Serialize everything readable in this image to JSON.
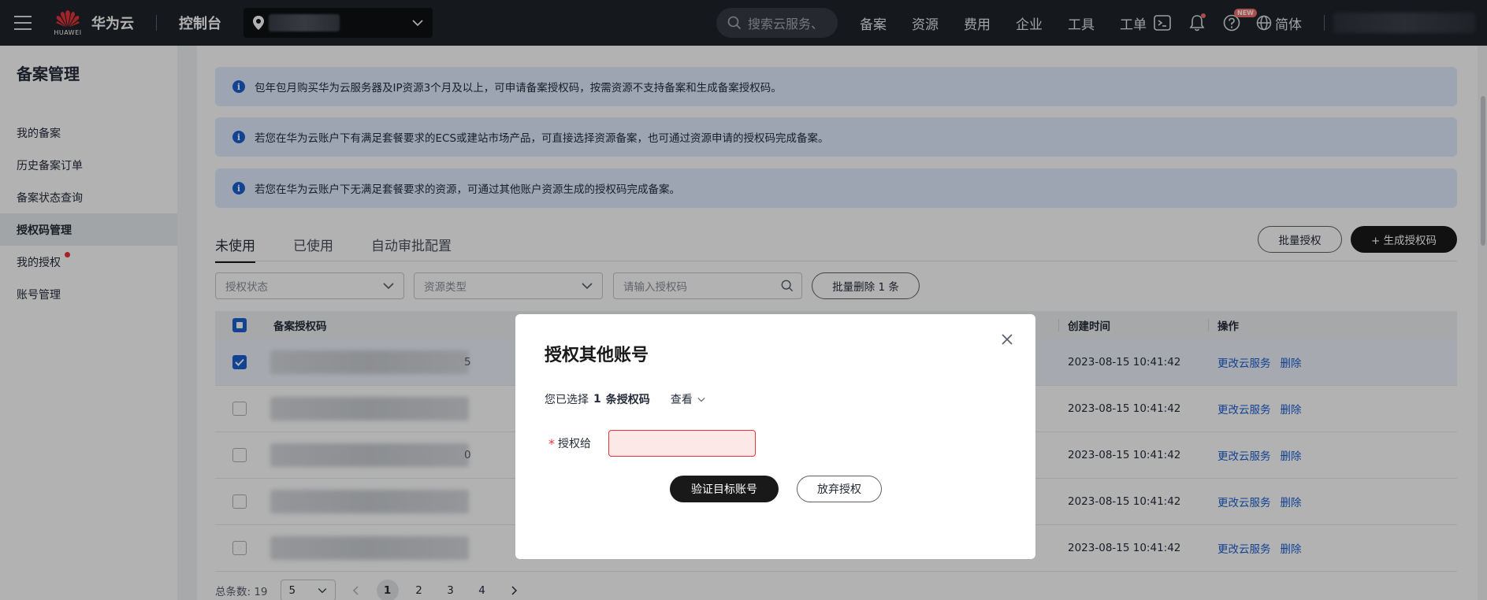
{
  "topbar": {
    "brand_small": "HUAWEI",
    "brand_name": "华为云",
    "console": "控制台",
    "search_placeholder": "搜索云服务、",
    "nav": [
      "备案",
      "资源",
      "费用",
      "企业",
      "工具",
      "工单"
    ],
    "new_badge": "NEW",
    "language": "简体"
  },
  "sidebar": {
    "title": "备案管理",
    "items": [
      {
        "label": "我的备案"
      },
      {
        "label": "历史备案订单"
      },
      {
        "label": "备案状态查询"
      },
      {
        "label": "授权码管理"
      },
      {
        "label": "我的授权"
      },
      {
        "label": "账号管理"
      }
    ]
  },
  "notices": [
    "包年包月购买华为云服务器及IP资源3个月及以上，可申请备案授权码，按需资源不支持备案和生成备案授权码。",
    "若您在华为云账户下有满足套餐要求的ECS或建站市场产品，可直接选择资源备案，也可通过资源申请的授权码完成备案。",
    "若您在华为云账户下无满足套餐要求的资源，可通过其他账户资源生成的授权码完成备案。"
  ],
  "tabs": [
    "未使用",
    "已使用",
    "自动审批配置"
  ],
  "actions": {
    "batch_auth": "批量授权",
    "generate": "+ 生成授权码"
  },
  "filters": {
    "auth_status": "授权状态",
    "resource_type": "资源类型",
    "search_placeholder": "请输入授权码",
    "batch_delete": "批量删除 1 条"
  },
  "table": {
    "headers": {
      "code": "备案授权码",
      "created": "创建时间",
      "ops": "操作"
    },
    "rows": [
      {
        "code_suffix": "5",
        "created": "2023-08-15 10:41:42",
        "op1": "更改云服务",
        "op2": "删除"
      },
      {
        "code_suffix": "",
        "created": "2023-08-15 10:41:42",
        "op1": "更改云服务",
        "op2": "删除"
      },
      {
        "code_suffix": "0",
        "created": "2023-08-15 10:41:42",
        "op1": "更改云服务",
        "op2": "删除"
      },
      {
        "code_suffix": "",
        "created": "2023-08-15 10:41:42",
        "op1": "更改云服务",
        "op2": "删除"
      },
      {
        "code_suffix": "",
        "created": "2023-08-15 10:41:42",
        "op1": "更改云服务",
        "op2": "删除"
      }
    ]
  },
  "pager": {
    "total_label": "总条数: 19",
    "page_size": "5",
    "pages": [
      "1",
      "2",
      "3",
      "4"
    ]
  },
  "modal": {
    "title": "授权其他账号",
    "selected_prefix": "您已选择",
    "selected_count": "1",
    "selected_unit": "条授权码",
    "view": "查看",
    "field_label": "授权给",
    "verify_button": "验证目标账号",
    "cancel_button": "放弃授权"
  }
}
